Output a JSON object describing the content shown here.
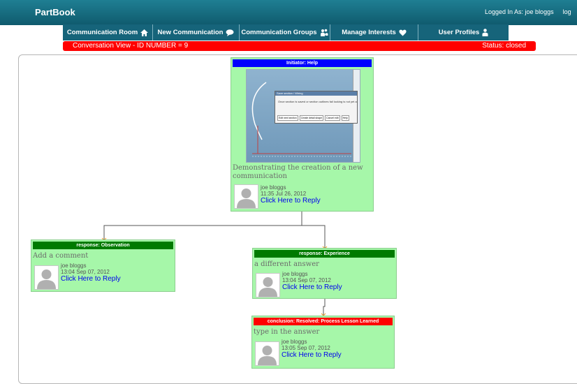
{
  "app": {
    "brand": "PartBook",
    "login_text": "Logged In As: joe bloggs",
    "logout_label": "log"
  },
  "nav": [
    {
      "label": "Communication Room",
      "icon": "home-icon"
    },
    {
      "label": "New Communication",
      "icon": "speech-bubble-icon"
    },
    {
      "label": "Communication Groups",
      "icon": "group-icon"
    },
    {
      "label": "Manage Interests",
      "icon": "heart-icon"
    },
    {
      "label": "User Profiles",
      "icon": "user-icon"
    }
  ],
  "conversation": {
    "title": "Conversation View - ID NUMBER = 9",
    "status": "Status: closed"
  },
  "colors": {
    "initiator": "#0000ff",
    "response": "#007a00",
    "conclusion": "#ff0000",
    "node_bg": "#a6f7a9",
    "link": "#0000ee"
  },
  "nodes": [
    {
      "header": "Initiator: Help",
      "text": "Demonstrating the creation of a new communication",
      "text_lines": [
        "Demonstrating the creation of a new",
        "communication"
      ],
      "author": "joe bloggs",
      "date": "11:35 Jul 26, 2012",
      "reply": "Click Here to Reply",
      "screenshot_dialog": {
        "title": "Save section / Wiring",
        "message": "Once section is saved or section outlines fail locking is not yet allowed",
        "buttons": [
          "Edit next section",
          "Create detail shape",
          "Cancel edit",
          "Help"
        ]
      }
    },
    {
      "header": "response: Observation",
      "text": "Add a comment",
      "author": "joe bloggs",
      "date": "13:04 Sep 07, 2012",
      "reply": "Click Here to Reply"
    },
    {
      "header": "response: Experience",
      "text": "a different answer",
      "author": "joe bloggs",
      "date": "13:04 Sep 07, 2012",
      "reply": "Click Here to Reply"
    },
    {
      "header": "conclusion: Resolved: Process Lesson Learned",
      "text": "type in the answer",
      "author": "joe bloggs",
      "date": "13:05 Sep 07, 2012",
      "reply": "Click Here to Reply"
    }
  ]
}
